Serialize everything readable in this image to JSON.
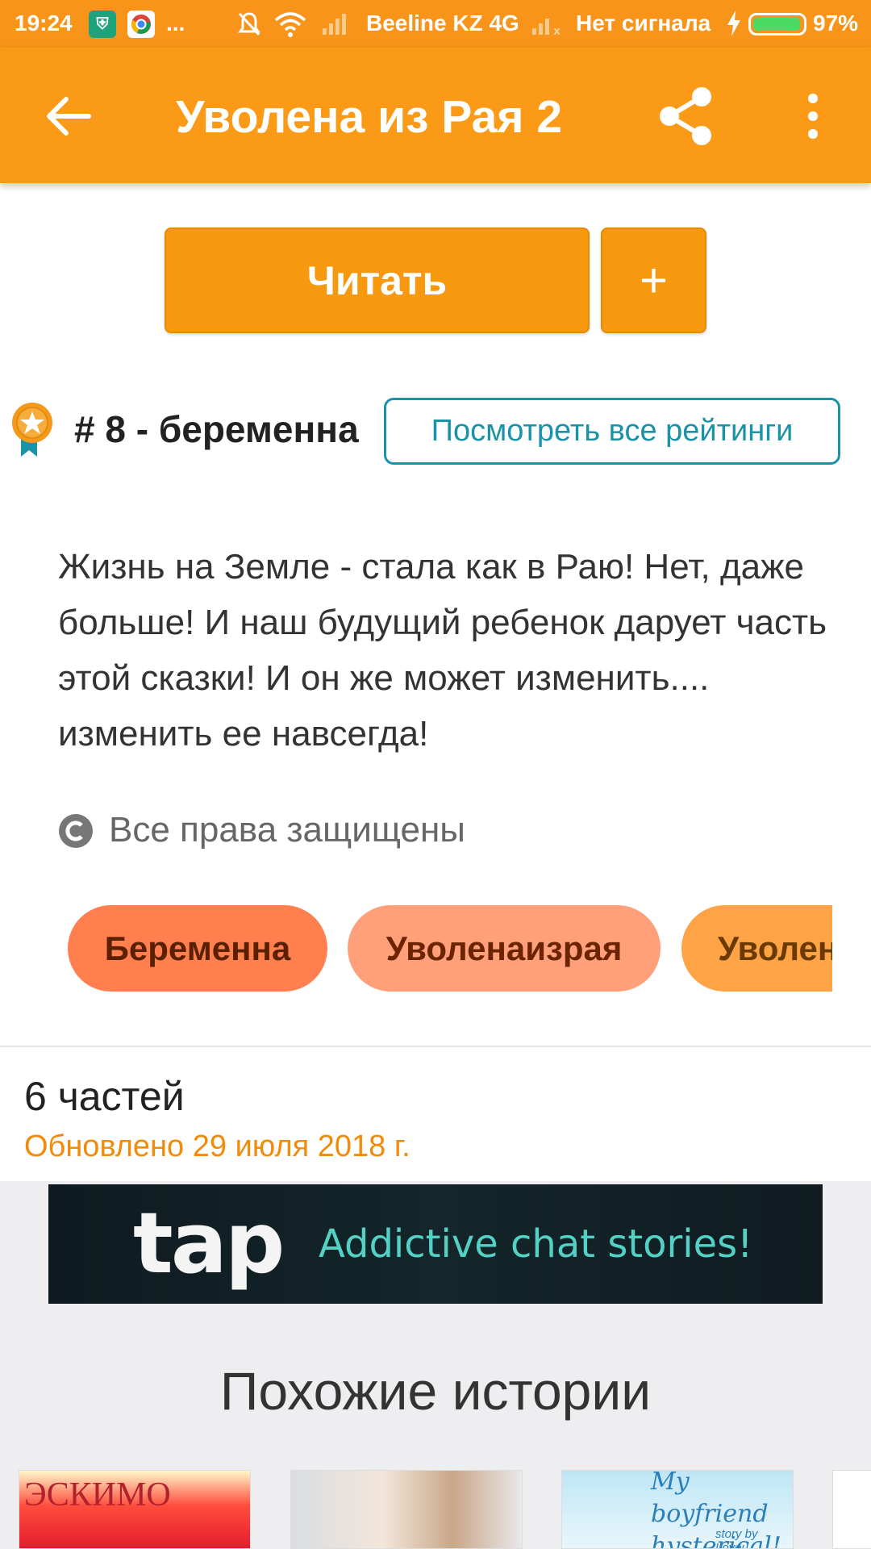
{
  "status_bar": {
    "time": "19:24",
    "carrier": "Beeline KZ 4G",
    "no_signal": "Нет сигнала",
    "battery": "97%",
    "battery_level": 0.97,
    "notif_more": "..."
  },
  "app_bar": {
    "title": "Уволена из Рая 2",
    "back_icon": "arrow-back-icon",
    "share_icon": "share-icon",
    "more_icon": "more-vert-icon"
  },
  "actions": {
    "read_label": "Читать",
    "add_label": "+"
  },
  "ranking": {
    "text": "# 8 - беременна",
    "view_all_label": "Посмотреть все рейтинги"
  },
  "description": "Жизнь на Земле - стала как в Раю! Нет, даже больше! И наш будущий ребенок дарует часть этой сказки! И он же может изменить.... изменить ее навсегда!",
  "copyright": "Все права защищены",
  "tags": [
    "Беременна",
    "Уволенаизрая",
    "Уволен"
  ],
  "parts": {
    "count": "6 частей",
    "updated": "Обновлено 29 июля 2018 г."
  },
  "ad": {
    "logo": "tap",
    "tagline": "Addictive chat stories!"
  },
  "similar": {
    "title": "Похожие истории",
    "covers": [
      {
        "text": "ЭСКИМО"
      },
      {
        "text": ""
      },
      {
        "text": "My boyfriend hysterical!",
        "sub": "story by Loveu"
      }
    ]
  },
  "colors": {
    "primary": "#fa9a16",
    "teal": "#1a92a8",
    "updated": "#f28a0a"
  }
}
